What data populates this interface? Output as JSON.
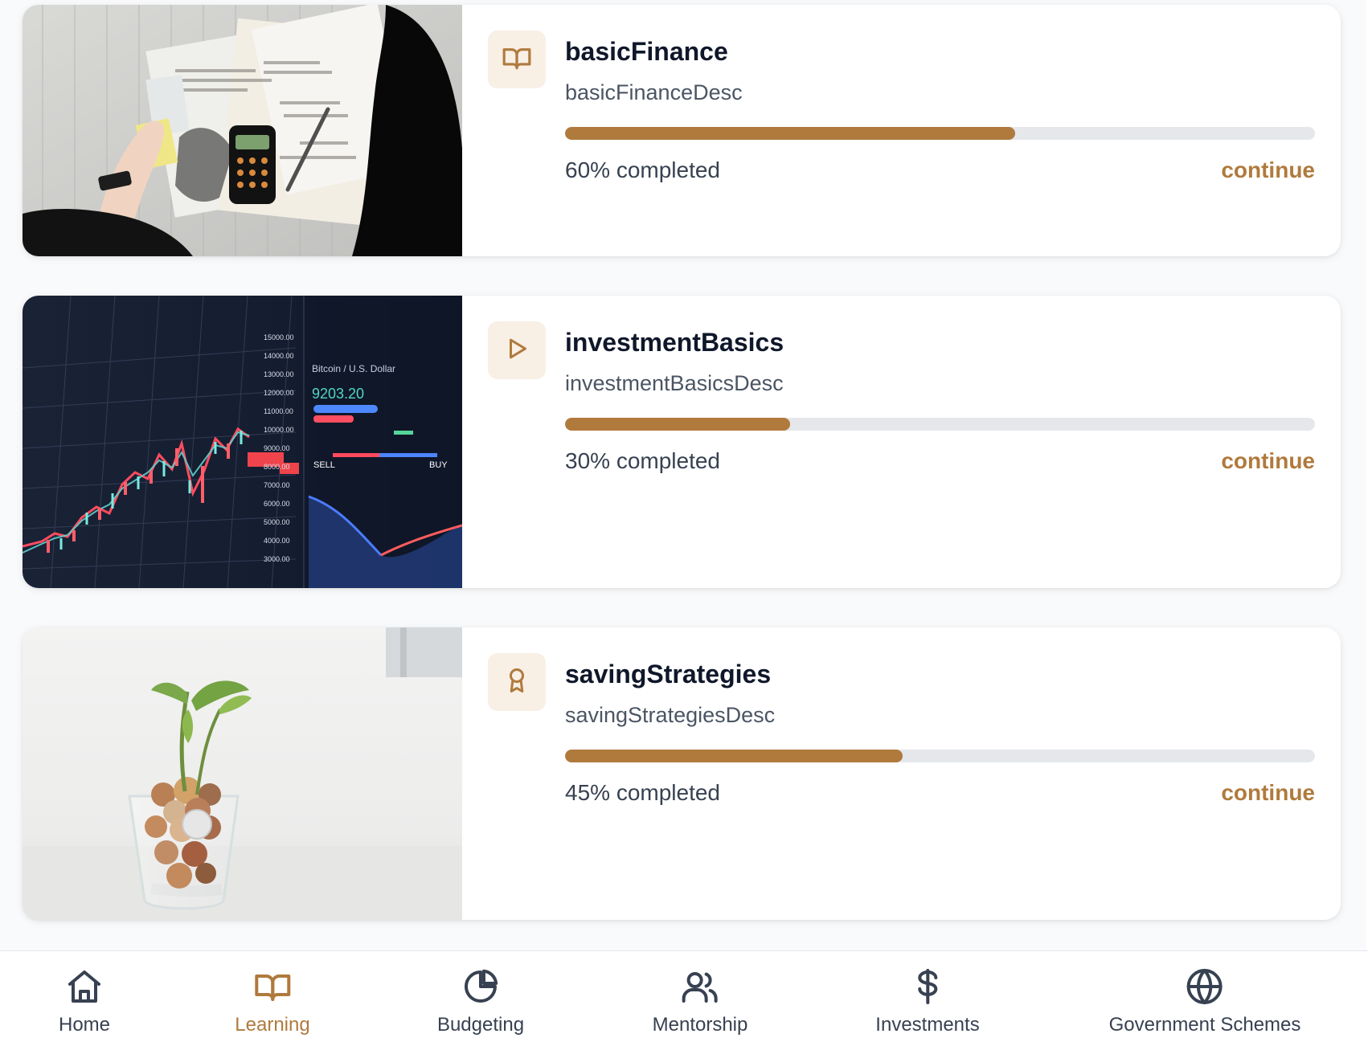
{
  "theme": {
    "accent": "#b07a3d",
    "track": "#e5e7eb",
    "icon_tile_bg": "#f8efe5",
    "text_primary": "#0f172a",
    "text_secondary": "#4b5563"
  },
  "courses": [
    {
      "title": "basicFinance",
      "description": "basicFinanceDesc",
      "progress_value": 60,
      "progress_text": "60% completed",
      "action": "continue",
      "icon": "book-open-icon",
      "image": "tax-documents-photo"
    },
    {
      "title": "investmentBasics",
      "description": "investmentBasicsDesc",
      "progress_value": 30,
      "progress_text": "30% completed",
      "action": "continue",
      "icon": "play-icon",
      "image": "stock-chart-photo"
    },
    {
      "title": "savingStrategies",
      "description": "savingStrategiesDesc",
      "progress_value": 45,
      "progress_text": "45% completed",
      "action": "continue",
      "icon": "award-icon",
      "image": "coins-plant-photo"
    }
  ],
  "bottom_nav": [
    {
      "label": "Home",
      "icon": "home-icon",
      "active": false
    },
    {
      "label": "Learning",
      "icon": "book-open-icon",
      "active": true
    },
    {
      "label": "Budgeting",
      "icon": "pie-chart-icon",
      "active": false
    },
    {
      "label": "Mentorship",
      "icon": "users-icon",
      "active": false
    },
    {
      "label": "Investments",
      "icon": "dollar-icon",
      "active": false
    },
    {
      "label": "Government Schemes",
      "icon": "globe-icon",
      "active": false
    }
  ]
}
